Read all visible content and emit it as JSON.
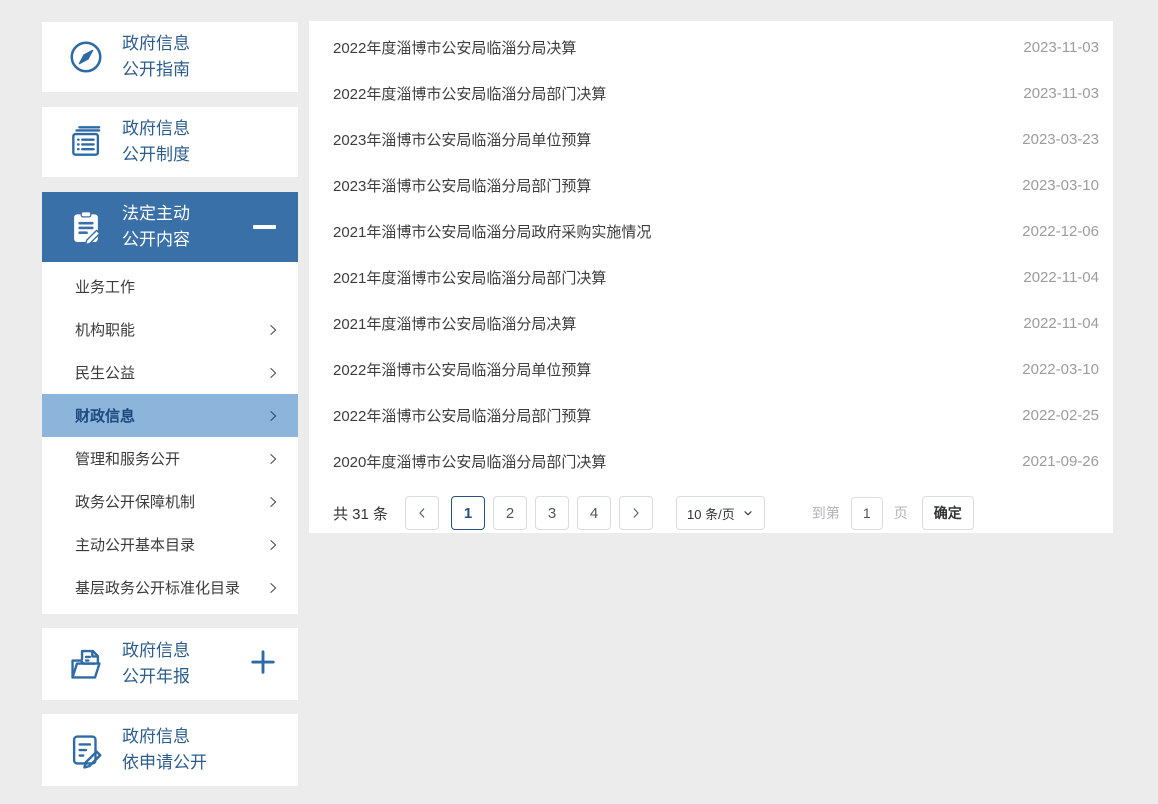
{
  "sidebar": {
    "sections": {
      "guide": {
        "line1": "政府信息",
        "line2": "公开指南"
      },
      "system": {
        "line1": "政府信息",
        "line2": "公开制度"
      },
      "legal": {
        "line1": "法定主动",
        "line2": "公开内容"
      },
      "annual": {
        "line1": "政府信息",
        "line2": "公开年报"
      },
      "request": {
        "line1": "政府信息",
        "line2": "依申请公开"
      }
    },
    "menu_items": [
      {
        "label": "业务工作"
      },
      {
        "label": "机构职能"
      },
      {
        "label": "民生公益"
      },
      {
        "label": "财政信息"
      },
      {
        "label": "管理和服务公开"
      },
      {
        "label": "政务公开保障机制"
      },
      {
        "label": "主动公开基本目录"
      },
      {
        "label": "基层政务公开标准化目录"
      }
    ],
    "active_item": "财政信息",
    "icons": {
      "guide": "compass-icon",
      "system": "book-icon",
      "legal": "clipboard-pen-icon",
      "annual": "folder-icon",
      "request": "doc-edit-icon",
      "collapse": "minus-icon",
      "expand": "plus-icon",
      "item_arrow": "chevron-right-icon"
    }
  },
  "list": {
    "items": [
      {
        "title": "2022年度淄博市公安局临淄分局决算",
        "date": "2023-11-03"
      },
      {
        "title": "2022年度淄博市公安局临淄分局部门决算",
        "date": "2023-11-03"
      },
      {
        "title": "2023年淄博市公安局临淄分局单位预算",
        "date": "2023-03-23"
      },
      {
        "title": "2023年淄博市公安局临淄分局部门预算",
        "date": "2023-03-10"
      },
      {
        "title": "2021年淄博市公安局临淄分局政府采购实施情况",
        "date": "2022-12-06"
      },
      {
        "title": "2021年度淄博市公安局临淄分局部门决算",
        "date": "2022-11-04"
      },
      {
        "title": "2021年度淄博市公安局临淄分局决算",
        "date": "2022-11-04"
      },
      {
        "title": "2022年淄博市公安局临淄分局单位预算",
        "date": "2022-03-10"
      },
      {
        "title": "2022年淄博市公安局临淄分局部门预算",
        "date": "2022-02-25"
      },
      {
        "title": "2020年度淄博市公安局临淄分局部门决算",
        "date": "2021-09-26"
      }
    ]
  },
  "pagination": {
    "total_label": "共 31 条",
    "pages": [
      "1",
      "2",
      "3",
      "4"
    ],
    "active_page": "1",
    "page_size_label": "10 条/页",
    "goto_prefix": "到第",
    "goto_value": "1",
    "goto_suffix": "页",
    "confirm_label": "确定"
  },
  "colors": {
    "accent_blue": "#2e6ba5",
    "active_section_bg": "#3a70a8",
    "active_item_bg": "#8db4da",
    "sidebar_label": "#2c5c8c",
    "date_text": "#9c9c9c",
    "page_bg": "#ececec"
  }
}
